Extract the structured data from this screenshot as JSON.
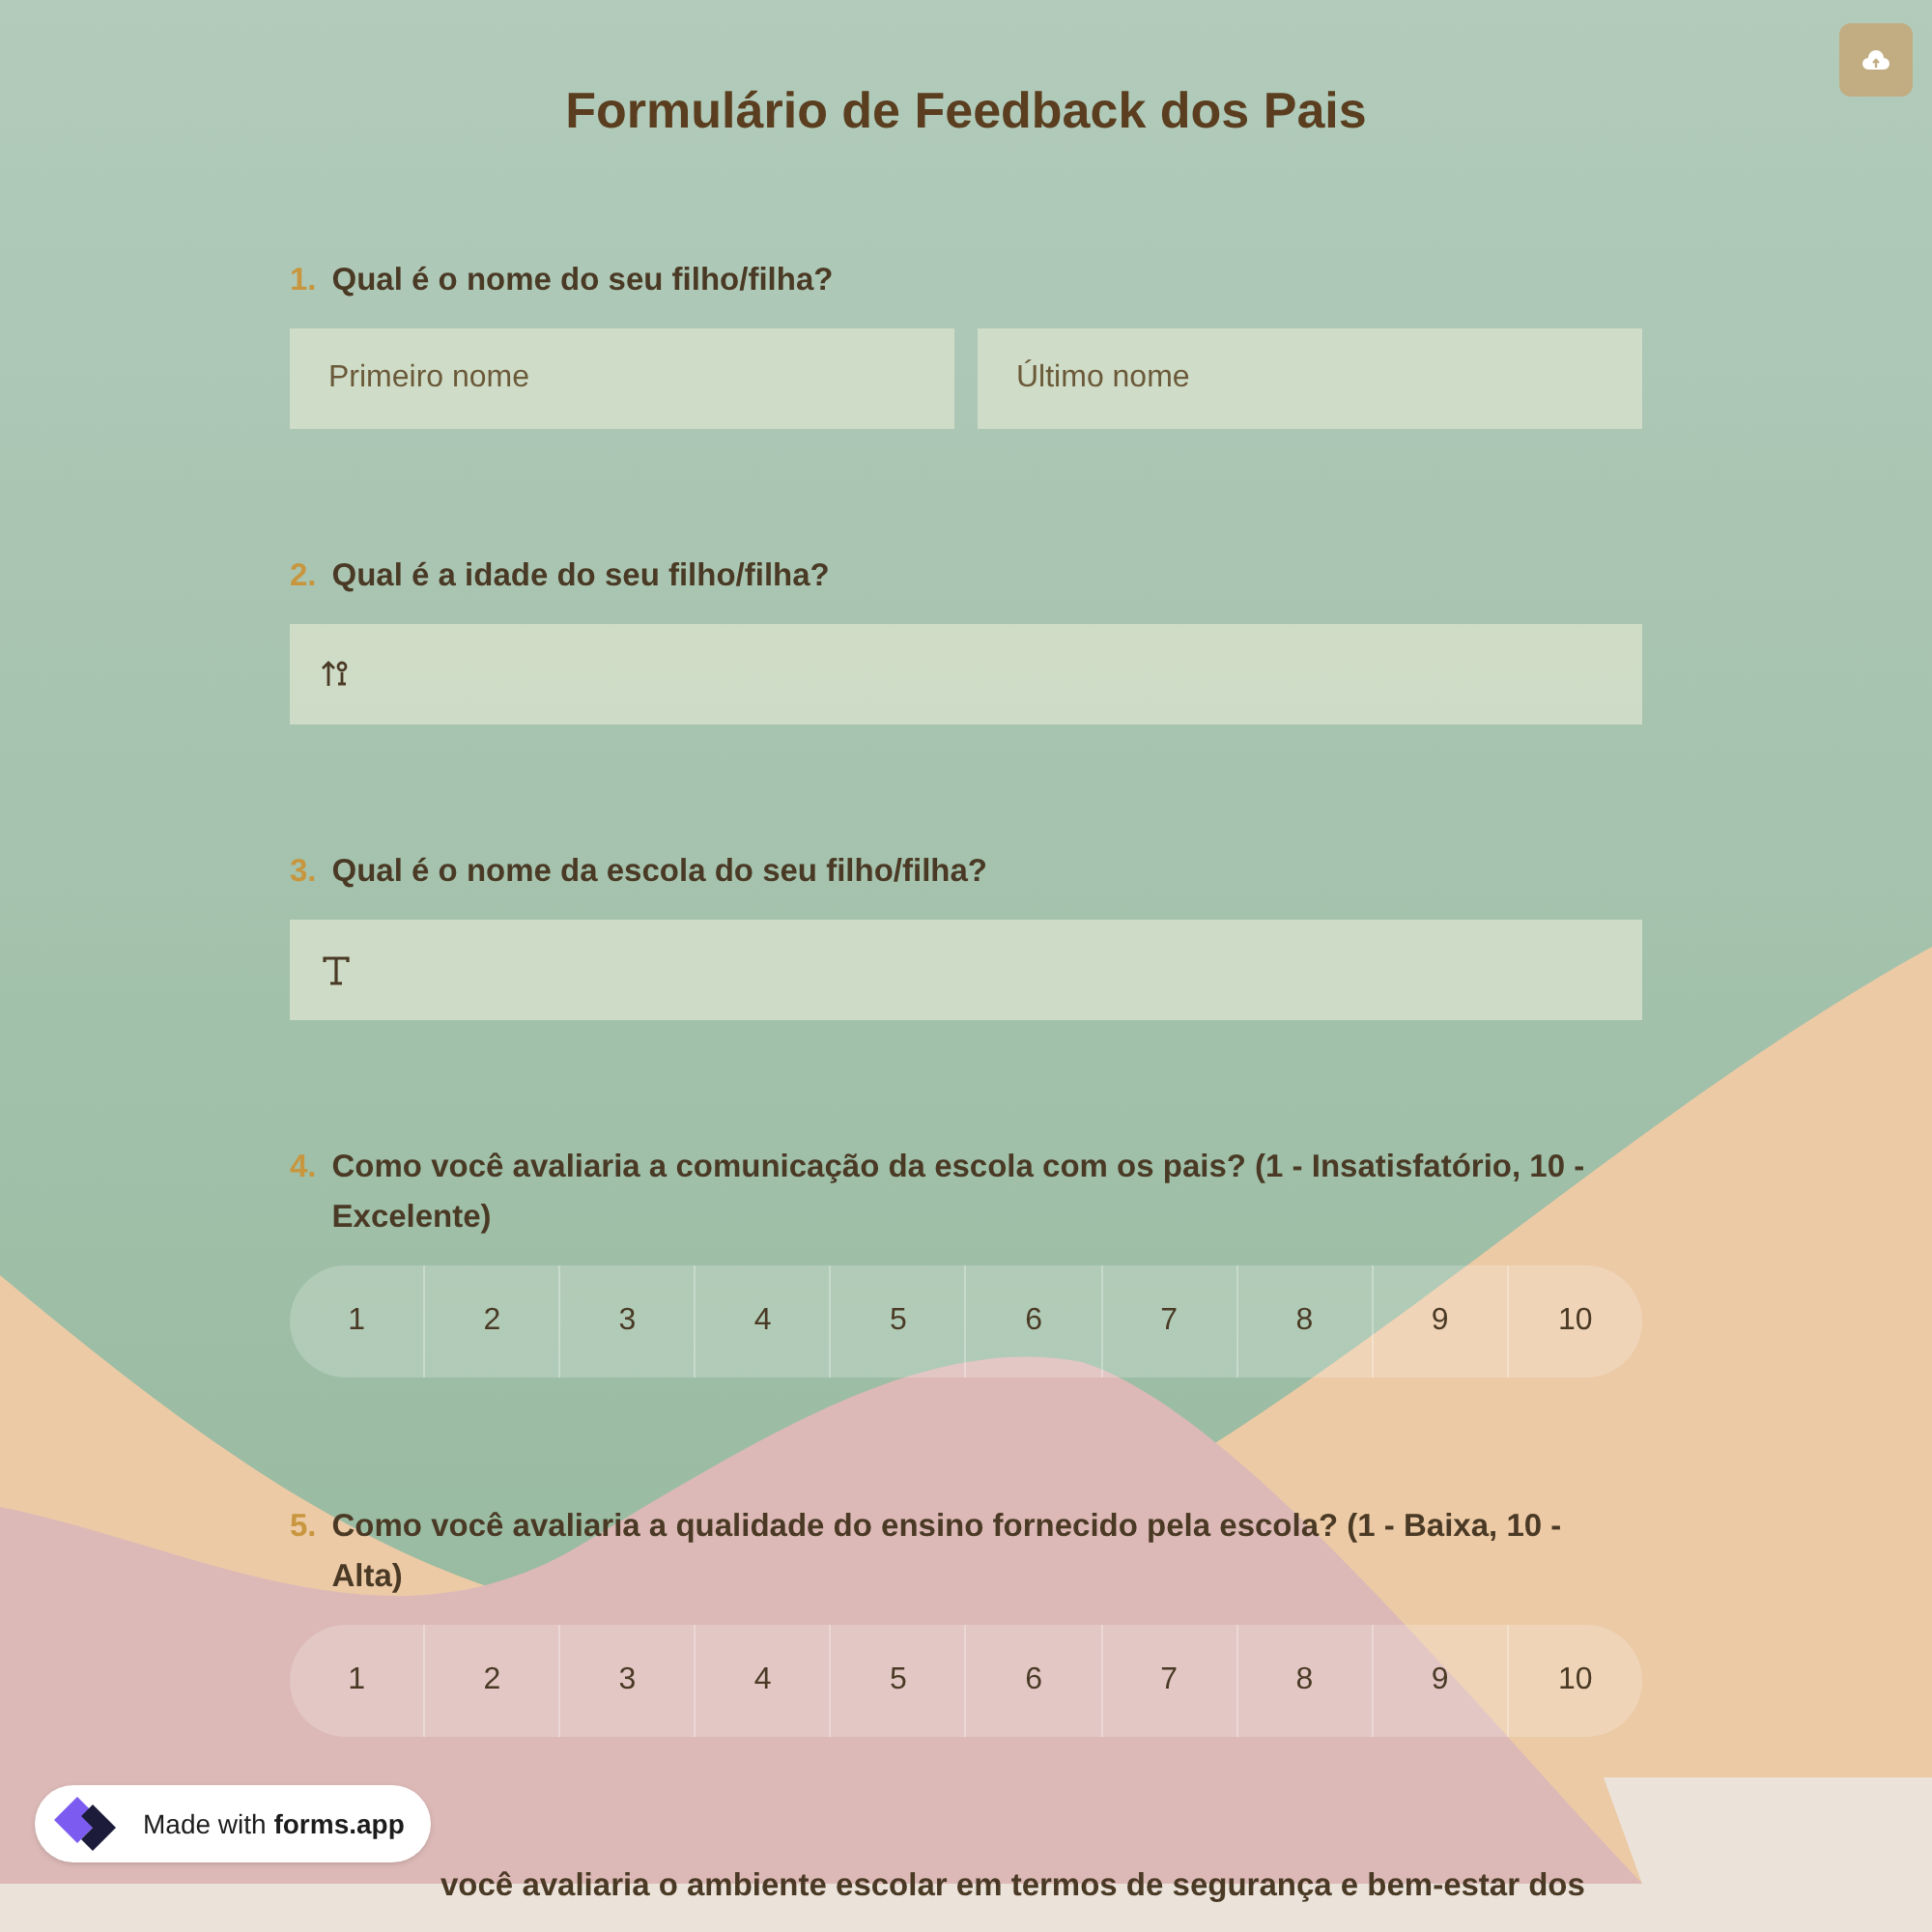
{
  "title": "Formulário de Feedback dos Pais",
  "questions": [
    {
      "number": "1.",
      "text": "Qual é o nome do seu filho/filha?",
      "kind": "name",
      "fields": [
        {
          "placeholder": "Primeiro nome"
        },
        {
          "placeholder": "Último nome"
        }
      ]
    },
    {
      "number": "2.",
      "text": "Qual é a idade do seu filho/filha?",
      "kind": "number"
    },
    {
      "number": "3.",
      "text": "Qual é o nome da escola do seu filho/filha?",
      "kind": "text"
    },
    {
      "number": "4.",
      "text": "Como você avaliaria a comunicação da escola com os pais? (1 - Insatisfatório, 10 - Excelente)",
      "kind": "scale",
      "options": [
        "1",
        "2",
        "3",
        "4",
        "5",
        "6",
        "7",
        "8",
        "9",
        "10"
      ]
    },
    {
      "number": "5.",
      "text": "Como você avaliaria a qualidade do ensino fornecido pela escola? (1 - Baixa, 10 - Alta)",
      "kind": "scale",
      "options": [
        "1",
        "2",
        "3",
        "4",
        "5",
        "6",
        "7",
        "8",
        "9",
        "10"
      ]
    },
    {
      "text": "você avaliaria o ambiente escolar em termos de segurança e bem-estar dos",
      "kind": "heading"
    }
  ],
  "badge": "Made with **forms.app**"
}
